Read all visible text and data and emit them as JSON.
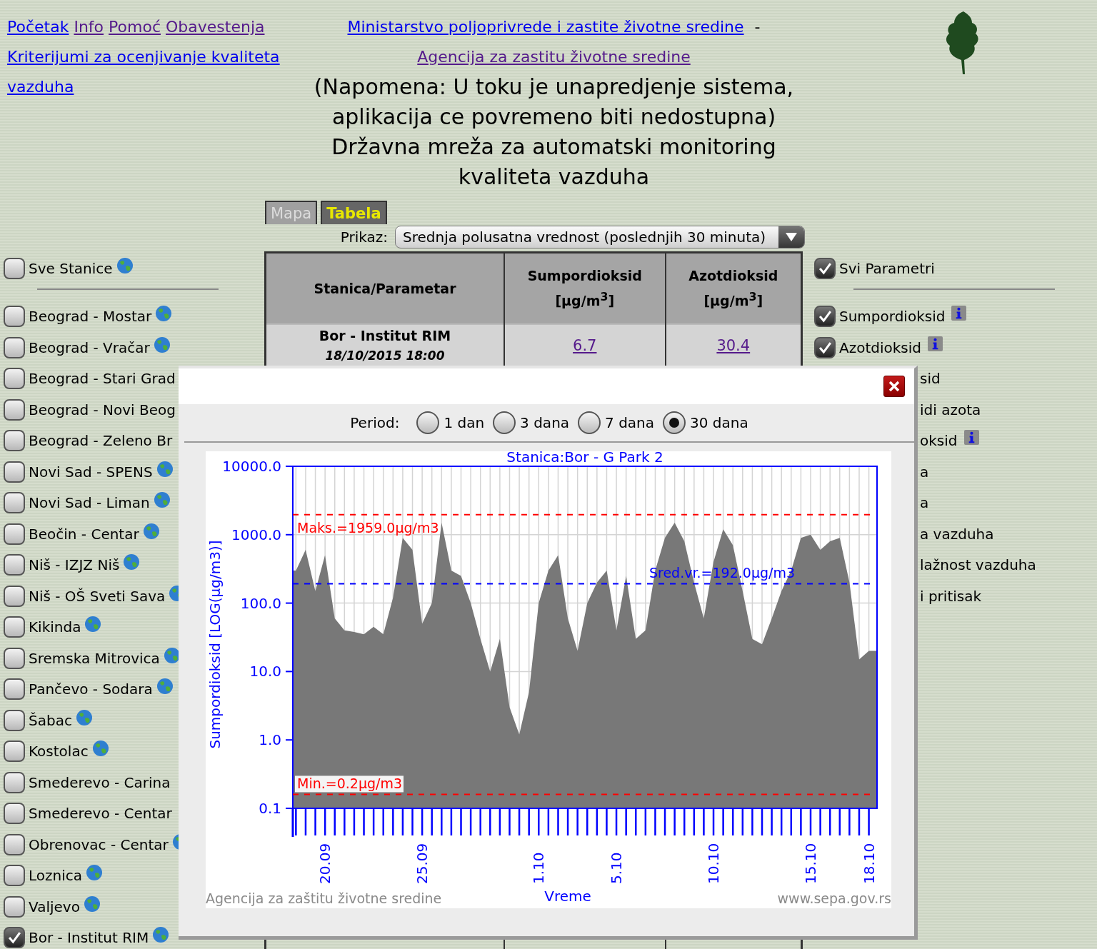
{
  "nav": {
    "links": [
      {
        "label": "Početak",
        "visited": false
      },
      {
        "label": "Info",
        "visited": true
      },
      {
        "label": "Pomoć",
        "visited": true
      },
      {
        "label": "Obavestenja",
        "visited": true
      },
      {
        "label": "Kriterijumi za ocenjivanje kvaliteta vazduha",
        "visited": false
      }
    ]
  },
  "header": {
    "links": [
      {
        "label": "Ministarstvo poljoprivrede i zastite životne sredine",
        "visited": false
      },
      {
        "label": "Agencija za zastitu životne sredine",
        "visited": true
      }
    ],
    "separator": "-",
    "notice": "(Napomena: U toku je unapredjenje sistema, aplikacija ce povremeno biti nedostupna)",
    "title": "Državna mreža za automatski monitoring kvaliteta vazduha"
  },
  "stations": {
    "all": {
      "label": "Sve Stanice",
      "checked": false,
      "globe": true
    },
    "items": [
      {
        "label": "Beograd - Mostar",
        "checked": false,
        "globe": true
      },
      {
        "label": "Beograd - Vračar",
        "checked": false,
        "globe": true
      },
      {
        "label": "Beograd - Stari Grad",
        "checked": false,
        "globe": false
      },
      {
        "label": "Beograd - Novi Beog",
        "checked": false,
        "globe": false
      },
      {
        "label": "Beograd - Zeleno Br",
        "checked": false,
        "globe": false
      },
      {
        "label": "Novi Sad - SPENS",
        "checked": false,
        "globe": true
      },
      {
        "label": "Novi Sad - Liman",
        "checked": false,
        "globe": true
      },
      {
        "label": "Beočin - Centar",
        "checked": false,
        "globe": true
      },
      {
        "label": "Niš - IZJZ Niš",
        "checked": false,
        "globe": true
      },
      {
        "label": "Niš - OŠ Sveti Sava",
        "checked": false,
        "globe": true
      },
      {
        "label": "Kikinda",
        "checked": false,
        "globe": true
      },
      {
        "label": "Sremska Mitrovica",
        "checked": false,
        "globe": true
      },
      {
        "label": "Pančevo - Sodara",
        "checked": false,
        "globe": true
      },
      {
        "label": "Šabac",
        "checked": false,
        "globe": true
      },
      {
        "label": "Kostolac",
        "checked": false,
        "globe": true
      },
      {
        "label": "Smederevo - Carina",
        "checked": false,
        "globe": false
      },
      {
        "label": "Smederevo - Centar",
        "checked": false,
        "globe": false
      },
      {
        "label": "Obrenovac - Centar",
        "checked": false,
        "globe": true
      },
      {
        "label": "Loznica",
        "checked": false,
        "globe": true
      },
      {
        "label": "Valjevo",
        "checked": false,
        "globe": true
      },
      {
        "label": "Bor - Institut RIM",
        "checked": true,
        "globe": true
      }
    ]
  },
  "tabs": [
    {
      "label": "Mapa",
      "selected": false
    },
    {
      "label": "Tabela",
      "selected": true
    }
  ],
  "display": {
    "label": "Prikaz:",
    "value": "Srednja polusatna vrednost (poslednjih 30 minuta)"
  },
  "table": {
    "columns": [
      "Stanica/Parametar",
      "Sumpordioksid [μg/m$^{3}$]",
      "Azotdioksid [μg/m$^{3}$]"
    ],
    "rows": [
      {
        "station": "Bor - Institut RIM",
        "time": "18/10/2015 18:00",
        "values": [
          "6.7",
          "30.4"
        ]
      }
    ]
  },
  "parameters": {
    "all": {
      "label": "Svi Parametri",
      "checked": true
    },
    "items": [
      {
        "label": "Sumpordioksid",
        "checked": true,
        "info": true
      },
      {
        "label": "Azotdioksid",
        "checked": true,
        "info": true
      }
    ],
    "partial_items": [
      {
        "label": "sid",
        "info": false
      },
      {
        "label": "idi azota",
        "info": false
      },
      {
        "label": "oksid",
        "info": true
      },
      {
        "label": "a",
        "info": false
      },
      {
        "label": "a",
        "info": false
      },
      {
        "label": "a vazduha",
        "info": false
      },
      {
        "label": "lažnost vazduha",
        "info": false
      },
      {
        "label": "i pritisak",
        "info": false
      }
    ]
  },
  "dialog": {
    "period": {
      "label": "Period:",
      "options": [
        {
          "label": "1 dan",
          "selected": false
        },
        {
          "label": "3 dana",
          "selected": false
        },
        {
          "label": "7 dana",
          "selected": false
        },
        {
          "label": "30 dana",
          "selected": true
        }
      ]
    },
    "chart": {
      "kind": "picture",
      "title": "Stanica:Bor - G Park 2",
      "ylabel": "Sumpordioksid [LOG(μg/m3)]",
      "xlabel": "Vreme",
      "ytick_labels": [
        "10000.0",
        "1000.0",
        "100.0",
        "10.0",
        "1.0",
        "0.1"
      ],
      "xtick_labels": [
        "20.09",
        "25.09",
        "1.10",
        "5.10",
        "10.10",
        "15.10",
        "18.10"
      ],
      "line_labels": [
        {
          "label": "Maks.=1959.0μg/m3",
          "color": "#ff0000"
        },
        {
          "label": "Sred.vr.=192.0μg/m3",
          "color": "#0000ff"
        },
        {
          "label": "Min.=0.2μg/m3",
          "color": "#ff0000"
        }
      ],
      "credit": "Agencija za zaštitu životne sredine",
      "website": "www.sepa.gov.rs"
    }
  }
}
